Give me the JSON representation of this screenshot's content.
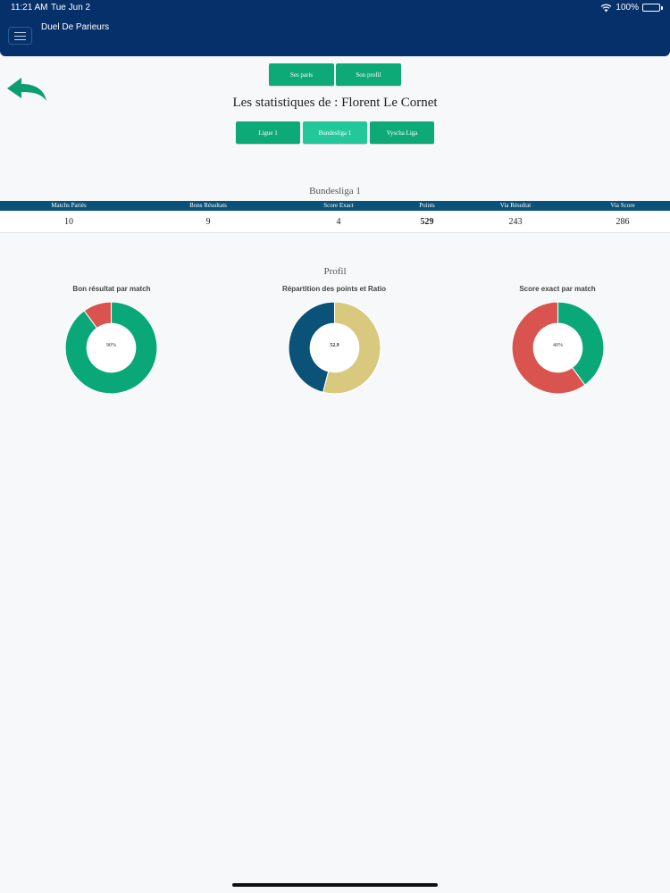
{
  "status_bar": {
    "time": "11:21 AM",
    "date": "Tue Jun 2",
    "battery": "100%",
    "battery_level": 1.0,
    "icons": [
      "wifi-icon",
      "battery-icon"
    ]
  },
  "header": {
    "app_title": "Duel De Parieurs",
    "background_color": "#06306a",
    "menu_icon": "hamburger-icon"
  },
  "back_icon": "back-arrow-icon",
  "nav": {
    "paris_label": "Ses paris",
    "profil_label": "Son profil"
  },
  "page_title": "Les statistiques de : Florent Le Cornet",
  "leagues": {
    "ligue1": "Ligue 1",
    "bundesliga": "Bundesliga 1",
    "vysha": "Vyscha Liga",
    "selected": "Bundesliga 1"
  },
  "stats": {
    "title": "Bundesliga 1",
    "headers": [
      "Matchs Pariés",
      "Bons Résultats",
      "Score Exact",
      "Points",
      "Via Résultat",
      "Via Score"
    ],
    "values": [
      "10",
      "9",
      "4",
      "529",
      "243",
      "286"
    ]
  },
  "profil": {
    "title": "Profil",
    "charts": [
      {
        "title": "Bon résultat par match",
        "center_label": "90%",
        "chart_data": {
          "type": "pie",
          "values": [
            90,
            10
          ],
          "colors": [
            "#0aa879",
            "#d9534f"
          ]
        }
      },
      {
        "title": "Répartition des points et Ratio",
        "center_label": "52.9",
        "chart_data": {
          "type": "pie",
          "values": [
            286,
            243
          ],
          "colors": [
            "#d8c97f",
            "#0a5277"
          ]
        }
      },
      {
        "title": "Score exact par match",
        "center_label": "40%",
        "chart_data": {
          "type": "pie",
          "values": [
            40,
            60
          ],
          "colors": [
            "#0aa879",
            "#d9534f"
          ]
        }
      }
    ]
  },
  "colors": {
    "button_green": "#0daa78",
    "button_active": "#22c89a",
    "table_header": "#0a5277"
  }
}
